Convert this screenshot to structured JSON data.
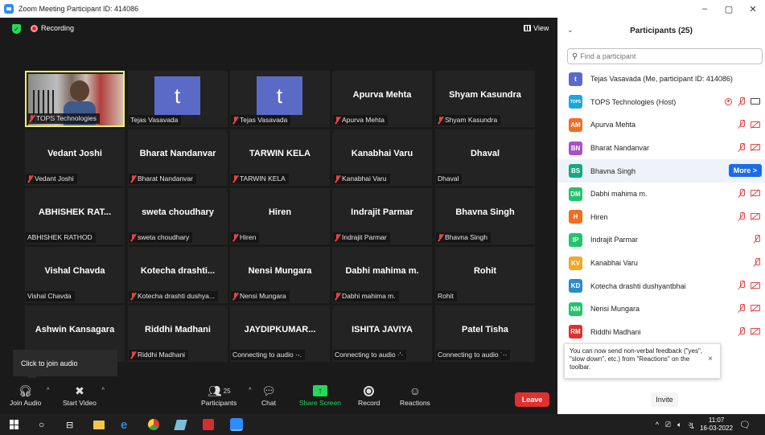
{
  "window": {
    "title": "Zoom Meeting Participant ID: 414086",
    "buttons": [
      "–",
      "▢",
      "✕"
    ]
  },
  "meeting": {
    "recording_label": "Recording",
    "view_label": "View",
    "tooltip": "Click to join audio",
    "tiles": [
      {
        "big": "",
        "label": "TOPS Technologies",
        "muted": true,
        "type": "video"
      },
      {
        "big": "t",
        "label": "Tejas Vasavada",
        "muted": false,
        "type": "avatar"
      },
      {
        "big": "t",
        "label": "Tejas Vasavada",
        "muted": true,
        "type": "avatar"
      },
      {
        "big": "Apurva Mehta",
        "label": "Apurva Mehta",
        "muted": true
      },
      {
        "big": "Shyam Kasundra",
        "label": "Shyam Kasundra",
        "muted": true
      },
      {
        "big": "Vedant Joshi",
        "label": "Vedant Joshi",
        "muted": true
      },
      {
        "big": "Bharat Nandanvar",
        "label": "Bharat Nandanvar",
        "muted": true
      },
      {
        "big": "TARWIN KELA",
        "label": "TARWIN KELA",
        "muted": true
      },
      {
        "big": "Kanabhai Varu",
        "label": "Kanabhai Varu",
        "muted": true
      },
      {
        "big": "Dhaval",
        "label": "Dhaval",
        "muted": false
      },
      {
        "big": "ABHISHEK RAT...",
        "label": "ABHISHEK RATHOD",
        "muted": false
      },
      {
        "big": "sweta choudhary",
        "label": "sweta choudhary",
        "muted": true
      },
      {
        "big": "Hiren",
        "label": "Hiren",
        "muted": true
      },
      {
        "big": "Indrajit Parmar",
        "label": "Indrajit Parmar",
        "muted": true
      },
      {
        "big": "Bhavna Singh",
        "label": "Bhavna Singh",
        "muted": true
      },
      {
        "big": "Vishal Chavda",
        "label": "Vishal Chavda",
        "muted": false
      },
      {
        "big": "Kotecha drashti...",
        "label": "Kotecha drashti dushya...",
        "muted": true
      },
      {
        "big": "Nensi Mungara",
        "label": "Nensi Mungara",
        "muted": true
      },
      {
        "big": "Dabhi mahima m.",
        "label": "Dabhi mahima m.",
        "muted": true
      },
      {
        "big": "Rohit",
        "label": "Rohit",
        "muted": false
      },
      {
        "big": "Ashwin Kansagara",
        "label": "",
        "muted": false
      },
      {
        "big": "Riddhi Madhani",
        "label": "Riddhi Madhani",
        "muted": true
      },
      {
        "big": "JAYDIPKUMAR...",
        "label": "Connecting to audio ·-.",
        "muted": false
      },
      {
        "big": "ISHITA JAVIYA",
        "label": "Connecting to audio ·'·",
        "muted": false
      },
      {
        "big": "Patel Tisha",
        "label": "Connecting to audio ˙··",
        "muted": false
      }
    ]
  },
  "toolbar": {
    "join_audio": "Join Audio",
    "start_video": "Start Video",
    "participants": "Participants",
    "participants_count": "25",
    "chat": "Chat",
    "share_screen": "Share Screen",
    "record": "Record",
    "reactions": "Reactions",
    "leave": "Leave"
  },
  "panel": {
    "title": "Participants (25)",
    "search_placeholder": "Find a participant",
    "more_label": "More >",
    "invite_label": "Invite",
    "notice": "You can now send non-verbal feedback (\"yes\", \"slow down\", etc.) from \"Reactions\" on the toolbar.",
    "notice_close": "×",
    "participants": [
      {
        "initials": "t",
        "name": "Tejas Vasavada (Me, participant ID: 414086)",
        "color": "#5b6ac7",
        "icons": ""
      },
      {
        "initials": "TOPS",
        "name": "TOPS Technologies (Host)",
        "color": "#1aa7e0",
        "icons": "share-mic-cam"
      },
      {
        "initials": "AM",
        "name": "Apurva Mehta",
        "color": "#f26d21",
        "icons": "mic-cam"
      },
      {
        "initials": "BN",
        "name": "Bharat Nandanvar",
        "color": "#a650c9",
        "icons": "mic-cam"
      },
      {
        "initials": "BS",
        "name": "Bhavna Singh",
        "color": "#12a883",
        "icons": "more"
      },
      {
        "initials": "DM",
        "name": "Dabhi  mahima m.",
        "color": "#23c46b",
        "icons": "mic-cam"
      },
      {
        "initials": "H",
        "name": "Hiren",
        "color": "#f26d21",
        "icons": "mic-cam"
      },
      {
        "initials": "IP",
        "name": "Indrajit Parmar",
        "color": "#23c46b",
        "icons": "mic"
      },
      {
        "initials": "KV",
        "name": "Kanabhai Varu",
        "color": "#f5a623",
        "icons": "mic"
      },
      {
        "initials": "KD",
        "name": "Kotecha drashti dushyantbhai",
        "color": "#2d8cc7",
        "icons": "mic-cam"
      },
      {
        "initials": "NM",
        "name": "Nensi Mungara",
        "color": "#23c46b",
        "icons": "mic-cam"
      },
      {
        "initials": "RM",
        "name": "Riddhi Madhani",
        "color": "#e0302f",
        "icons": "mic-cam"
      }
    ]
  },
  "taskbar": {
    "time": "11:07",
    "date": "16-03-2022",
    "lang": "ગુ"
  }
}
